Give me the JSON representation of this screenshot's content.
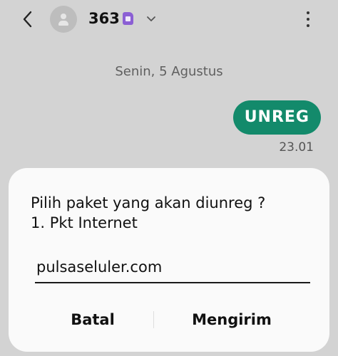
{
  "header": {
    "back_icon": "chevron-left-icon",
    "avatar_icon": "person-icon",
    "contact": "363",
    "sim_icon": "sim-card-icon",
    "expand_icon": "chevron-down-icon",
    "menu_icon": "more-vertical-icon"
  },
  "conversation": {
    "date": "Senin, 5 Agustus",
    "messages": [
      {
        "direction": "outgoing",
        "text": "UNREG",
        "time": "23.01"
      }
    ]
  },
  "dialog": {
    "prompt_line1": "Pilih paket yang akan diunreg ?",
    "prompt_line2": "1. Pkt Internet",
    "input_value": "pulsaseluler.com",
    "cancel_label": "Batal",
    "send_label": "Mengirim"
  },
  "colors": {
    "background": "#d3d3d3",
    "bubble": "#138a6b",
    "sim_badge": "#8b5fd4",
    "dialog": "#fafafa"
  }
}
